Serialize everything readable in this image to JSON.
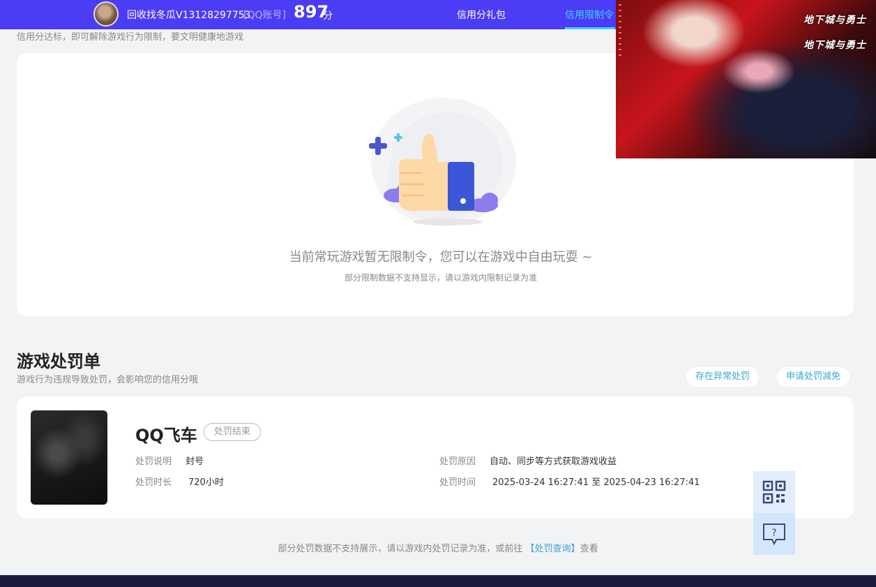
{
  "header": {
    "username": "回收找冬瓜V13128297753",
    "account_type": "[QQ账号]",
    "score": "897",
    "score_unit": "分",
    "nav": {
      "gift_pack": "信用分礼包",
      "restriction_order": "信用限制令"
    }
  },
  "restriction": {
    "subtitle": "信用分达标，即可解除游戏行为限制，要文明健康地游戏",
    "empty_title": "当前常玩游戏暂无限制令，您可以在游戏中自由玩耍 ~",
    "empty_note": "部分限制数据不支持显示，请以游戏内限制记录为准"
  },
  "ad": {
    "logo_1": "地下城与勇士",
    "logo_2": "地下城与勇士"
  },
  "punishment": {
    "title": "游戏处罚单",
    "subtitle": "游戏行为违规导致处罚，会影响您的信用分哦",
    "abnormal_button": "存在异常处罚",
    "appeal_button": "申请处罚减免",
    "record": {
      "game_name": "QQ飞车",
      "status": "处罚结束",
      "desc_label": "处罚说明",
      "desc_value": "封号",
      "duration_label": "处罚时长",
      "duration_value": "720小时",
      "reason_label": "处罚原因",
      "reason_value": "自动、同步等方式获取游戏收益",
      "time_label": "处罚时间",
      "time_value": "2025-03-24 16:27:41 至 2025-04-23 16:27:41"
    }
  },
  "footer": {
    "note_prefix": "部分处罚数据不支持展示，请以游戏内处罚记录为准，或前往 ",
    "note_link": "【处罚查询】",
    "note_suffix": "查看"
  },
  "side": {
    "qr_icon": "qr-code-icon",
    "help_icon": "help-bubble-icon"
  },
  "colors": {
    "header_bg": "#4b3cf5",
    "accent_cyan": "#3fd2ff",
    "link_blue": "#3aa5d8",
    "footer_bar": "#1a1b3a"
  }
}
